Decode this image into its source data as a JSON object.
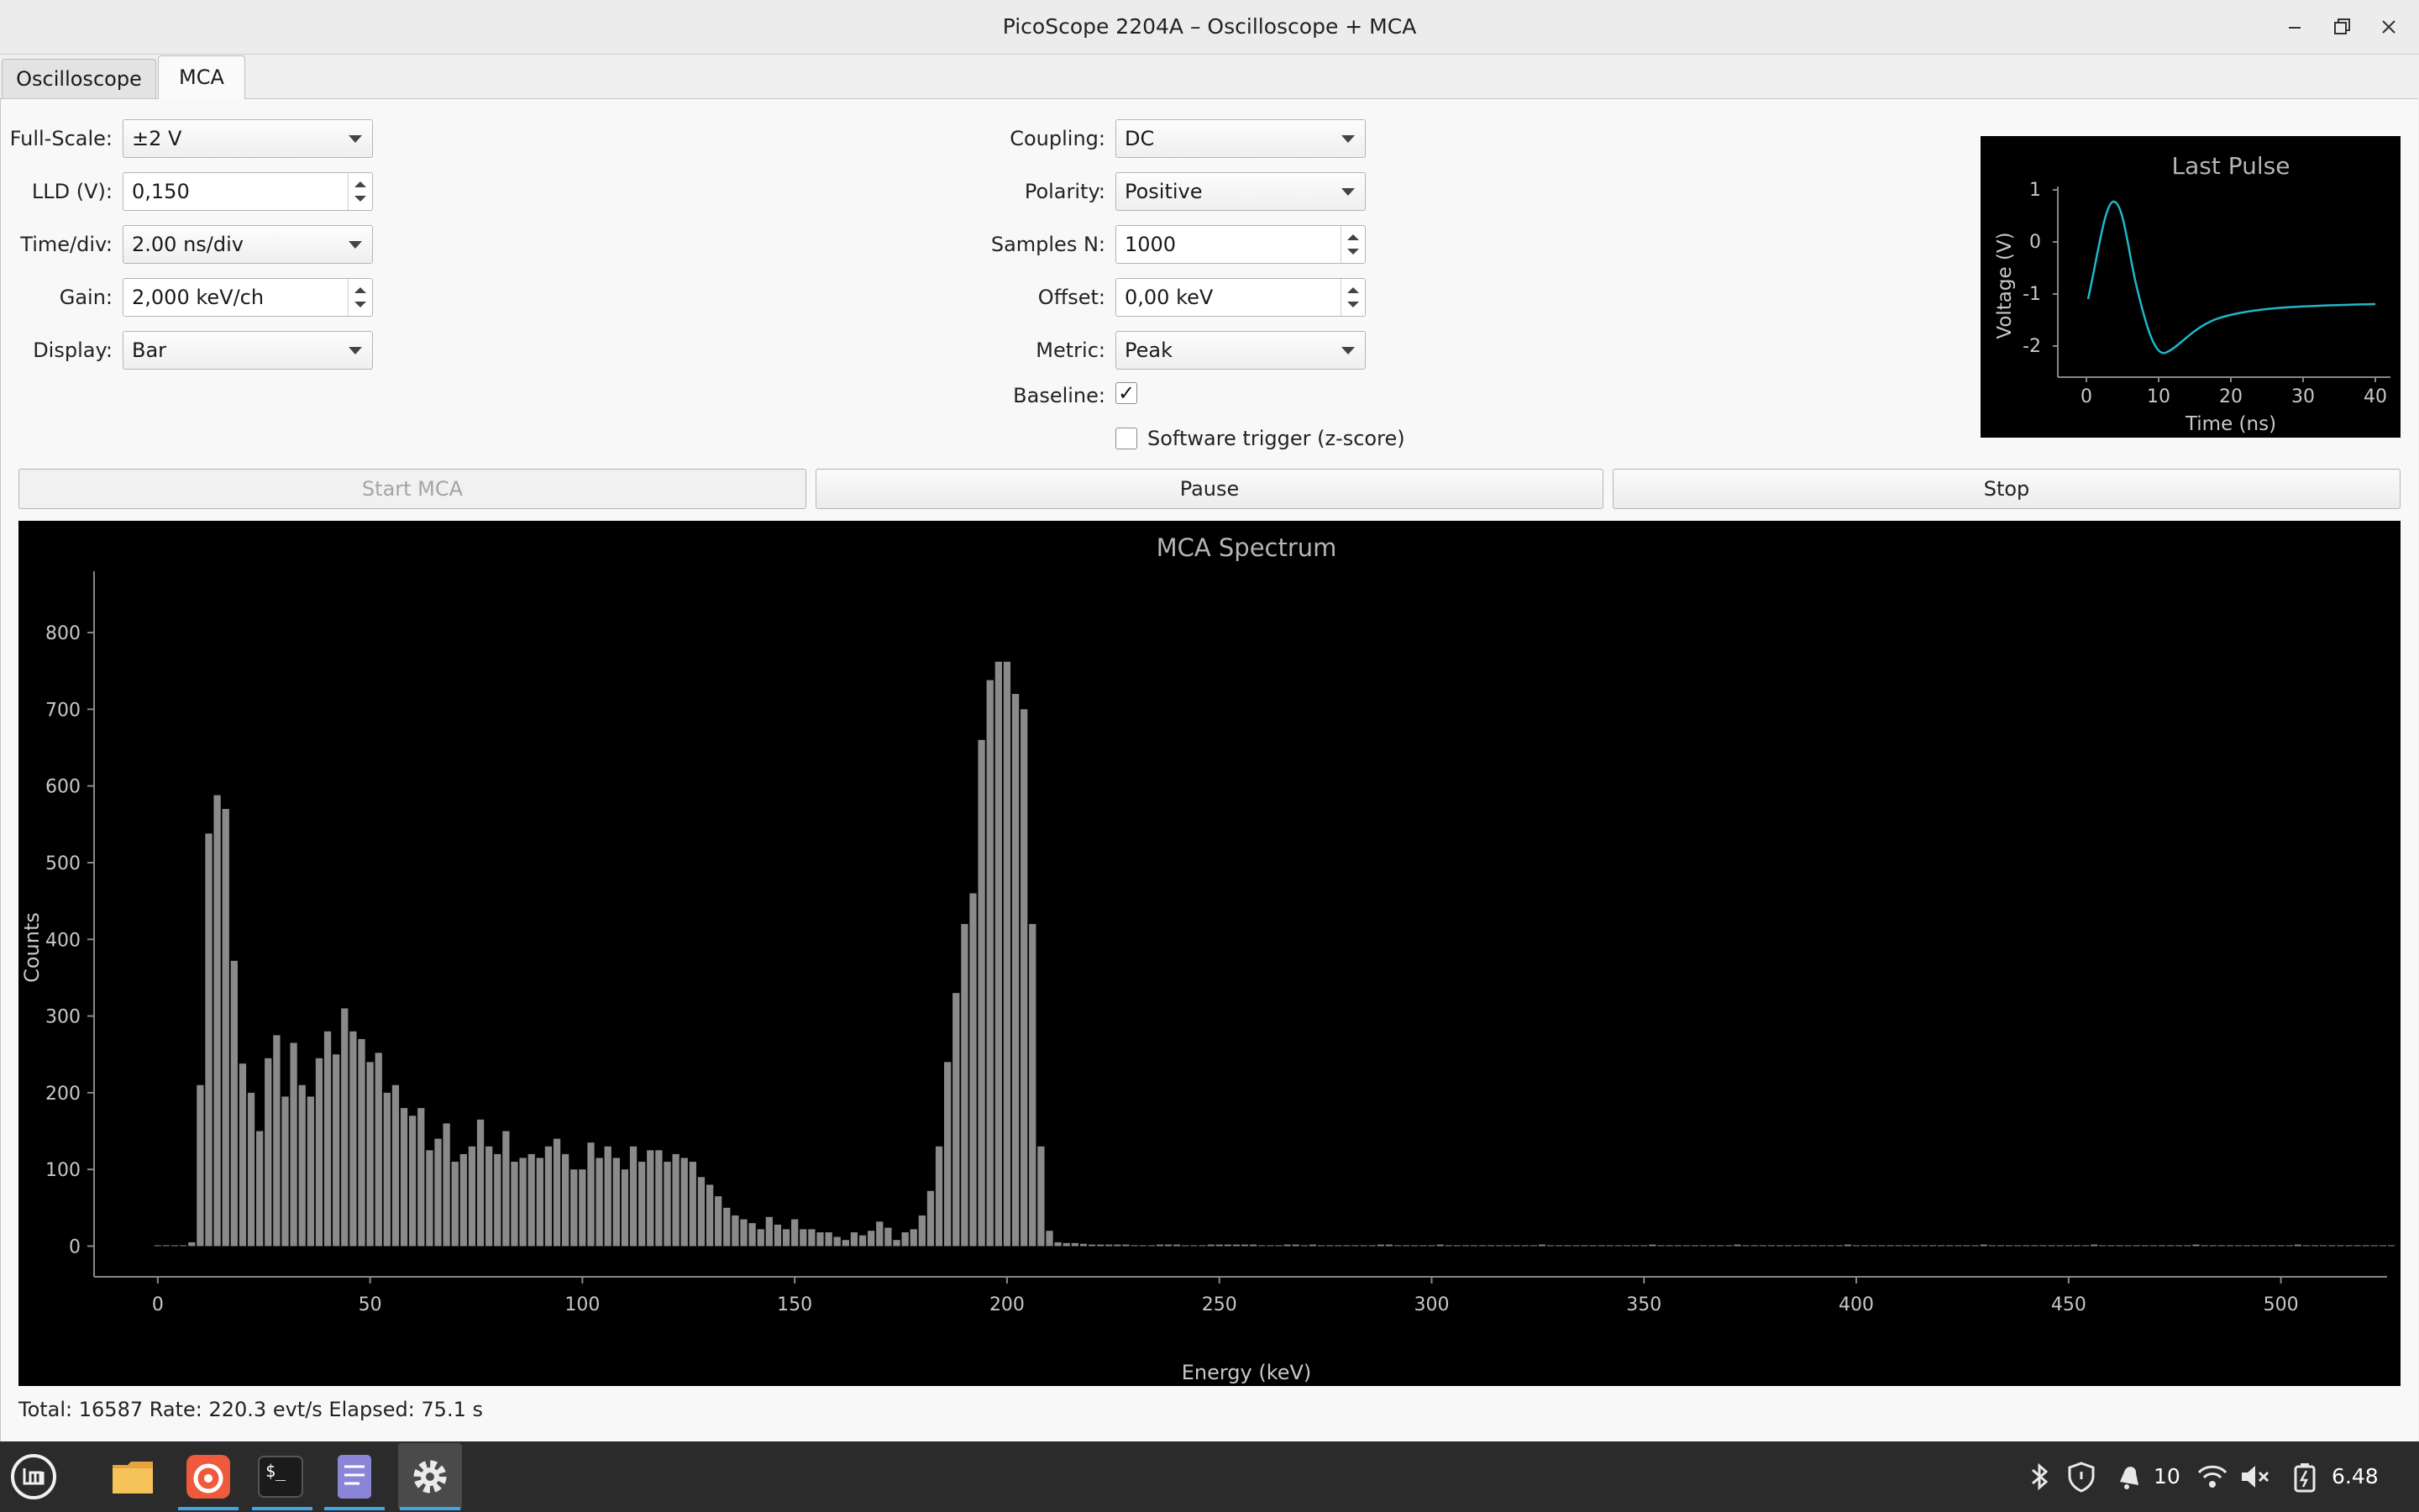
{
  "window": {
    "title": "PicoScope 2204A – Oscilloscope + MCA"
  },
  "tabs": [
    {
      "label": "Oscilloscope"
    },
    {
      "label": "MCA"
    }
  ],
  "left_controls": {
    "full_scale": {
      "label": "Full-Scale:",
      "value": "±2 V"
    },
    "lld": {
      "label": "LLD (V):",
      "value": "0,150"
    },
    "time_div": {
      "label": "Time/div:",
      "value": "2.00 ns/div"
    },
    "gain": {
      "label": "Gain:",
      "value": "2,000 keV/ch"
    },
    "display": {
      "label": "Display:",
      "value": "Bar"
    }
  },
  "mid_controls": {
    "coupling": {
      "label": "Coupling:",
      "value": "DC"
    },
    "polarity": {
      "label": "Polarity:",
      "value": "Positive"
    },
    "samples": {
      "label": "Samples N:",
      "value": "1000"
    },
    "offset": {
      "label": "Offset:",
      "value": "0,00 keV"
    },
    "metric": {
      "label": "Metric:",
      "value": "Peak"
    },
    "baseline": {
      "label": "Baseline:",
      "checked": true,
      "mark": "✓"
    },
    "software_trigger": {
      "label": "Software trigger (z-score)",
      "checked": false
    }
  },
  "buttons": {
    "start": "Start MCA",
    "pause": "Pause",
    "stop": "Stop"
  },
  "pulse_plot": {
    "title": "Last Pulse",
    "ylabel": "Voltage (V)",
    "xlabel": "Time (ns)",
    "xticks": [
      "0",
      "10",
      "20",
      "30",
      "40"
    ],
    "yticks": [
      "1",
      "0",
      "-1",
      "-2"
    ],
    "trace_color": "#1fb8c9"
  },
  "chart_data": {
    "type": "bar",
    "title": "MCA Spectrum",
    "xlabel": "Energy (keV)",
    "ylabel": "Counts",
    "xlim": [
      -15,
      525
    ],
    "ylim": [
      -40,
      880
    ],
    "xticks": [
      0,
      50,
      100,
      150,
      200,
      250,
      300,
      350,
      400,
      450,
      500
    ],
    "yticks": [
      0,
      100,
      200,
      300,
      400,
      500,
      600,
      700,
      800
    ],
    "bin_width_kev": 2,
    "bar_color": "#8a8a8a",
    "x_start_kev": 0,
    "counts": [
      0,
      0,
      0,
      0,
      5,
      210,
      538,
      588,
      570,
      372,
      238,
      200,
      150,
      245,
      275,
      195,
      265,
      210,
      195,
      245,
      280,
      250,
      310,
      280,
      270,
      240,
      252,
      200,
      210,
      180,
      170,
      180,
      125,
      140,
      160,
      110,
      120,
      130,
      165,
      130,
      120,
      150,
      110,
      115,
      120,
      115,
      130,
      140,
      120,
      100,
      100,
      135,
      115,
      130,
      115,
      100,
      130,
      110,
      125,
      125,
      110,
      120,
      115,
      110,
      90,
      80,
      65,
      50,
      40,
      35,
      30,
      22,
      38,
      28,
      22,
      35,
      22,
      22,
      18,
      18,
      12,
      8,
      18,
      14,
      20,
      32,
      24,
      8,
      18,
      22,
      40,
      72,
      130,
      240,
      330,
      420,
      460,
      660,
      738,
      762,
      762,
      720,
      700,
      420,
      130,
      20,
      5,
      4,
      4,
      3,
      2,
      2,
      2,
      2,
      2,
      1,
      1,
      1,
      2,
      2,
      2,
      1,
      1,
      1,
      2,
      2,
      2,
      2,
      2,
      2,
      1,
      1,
      1,
      2,
      2,
      1,
      2,
      1,
      1,
      1,
      1,
      1,
      1,
      1,
      2,
      2,
      1,
      1,
      1,
      1,
      1,
      2,
      1,
      1,
      1,
      1,
      1,
      1,
      1,
      1,
      1,
      1,
      1,
      2,
      1,
      1,
      1,
      1,
      1,
      1,
      1,
      1,
      1,
      1,
      1,
      1,
      2,
      1,
      1,
      1,
      1,
      1,
      1,
      1,
      1,
      1,
      2,
      1,
      1,
      1,
      1,
      1,
      1,
      1,
      1,
      1,
      1,
      1,
      1,
      2,
      1,
      1,
      1,
      1,
      1,
      1,
      1,
      1,
      1,
      1,
      1,
      1,
      1,
      1,
      1,
      2,
      1,
      1,
      1,
      1,
      1,
      1,
      1,
      1,
      1,
      1,
      1,
      1,
      2,
      1,
      1,
      1,
      1,
      1,
      1,
      1,
      1,
      1,
      1,
      1,
      2,
      1,
      1,
      1,
      1,
      1,
      1,
      1,
      1,
      1,
      1,
      1,
      2,
      1,
      1,
      1,
      1,
      1,
      1,
      1,
      1,
      1,
      1,
      1
    ]
  },
  "status": {
    "text": "Total: 16587  Rate: 220.3 evt/s  Elapsed: 75.1 s"
  },
  "taskbar": {
    "apps": [
      "menu-icon",
      "files-icon",
      "browser-icon",
      "terminal-icon",
      "text-editor-icon",
      "settings-icon"
    ],
    "tray_number": "10",
    "clock": "6.48"
  }
}
